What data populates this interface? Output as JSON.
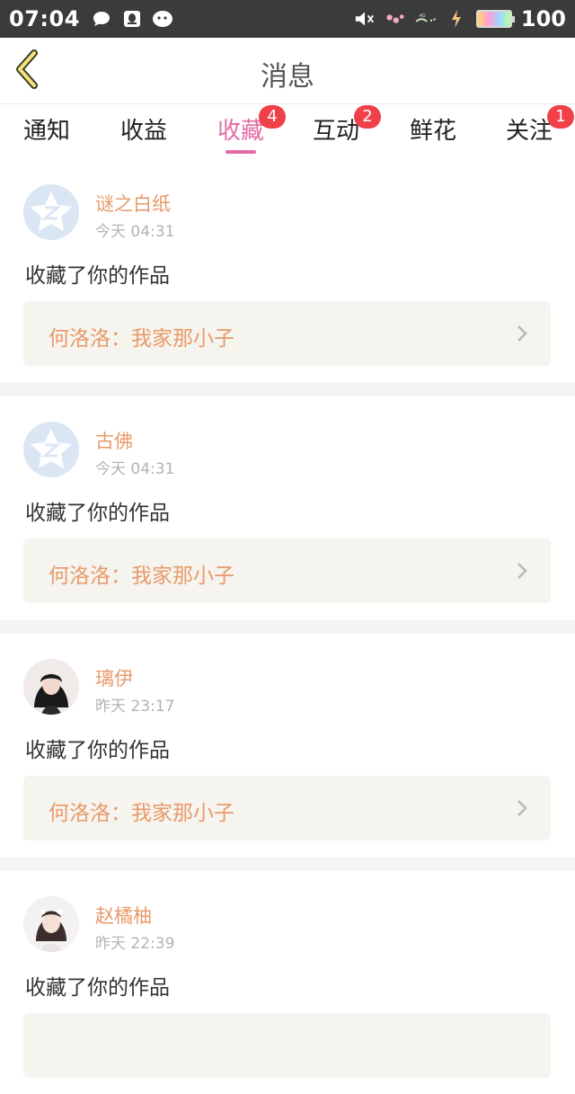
{
  "status_bar": {
    "time": "07:04",
    "battery": "100",
    "icons": [
      "message-bubble-icon",
      "qq-icon",
      "wechat-icon",
      "mute-icon",
      "signal-4g-icon",
      "charging-icon",
      "battery-icon"
    ]
  },
  "header": {
    "title": "消息",
    "back_icon": "chevron-left-icon"
  },
  "tabs": [
    {
      "label": "通知",
      "badge": null
    },
    {
      "label": "收益",
      "badge": null
    },
    {
      "label": "收藏",
      "badge": "4",
      "active": true
    },
    {
      "label": "互动",
      "badge": "2"
    },
    {
      "label": "鲜花",
      "badge": null
    },
    {
      "label": "关注",
      "badge": "1"
    }
  ],
  "accent_color": "#e26ba4",
  "name_color": "#e89a6a",
  "badge_color": "#f0414a",
  "messages": [
    {
      "name": "谜之白纸",
      "time": "今天 04:31",
      "action": "收藏了你的作品",
      "work": "何洛洛：我家那小子",
      "avatar": "default-avatar-icon"
    },
    {
      "name": "古佛",
      "time": "今天 04:31",
      "action": "收藏了你的作品",
      "work": "何洛洛：我家那小子",
      "avatar": "default-avatar-icon"
    },
    {
      "name": "璃伊",
      "time": "昨天 23:17",
      "action": "收藏了你的作品",
      "work": "何洛洛：我家那小子",
      "avatar": "user-photo"
    },
    {
      "name": "赵橘柚",
      "time": "昨天 22:39",
      "action": "收藏了你的作品",
      "work": "",
      "avatar": "user-photo"
    }
  ]
}
